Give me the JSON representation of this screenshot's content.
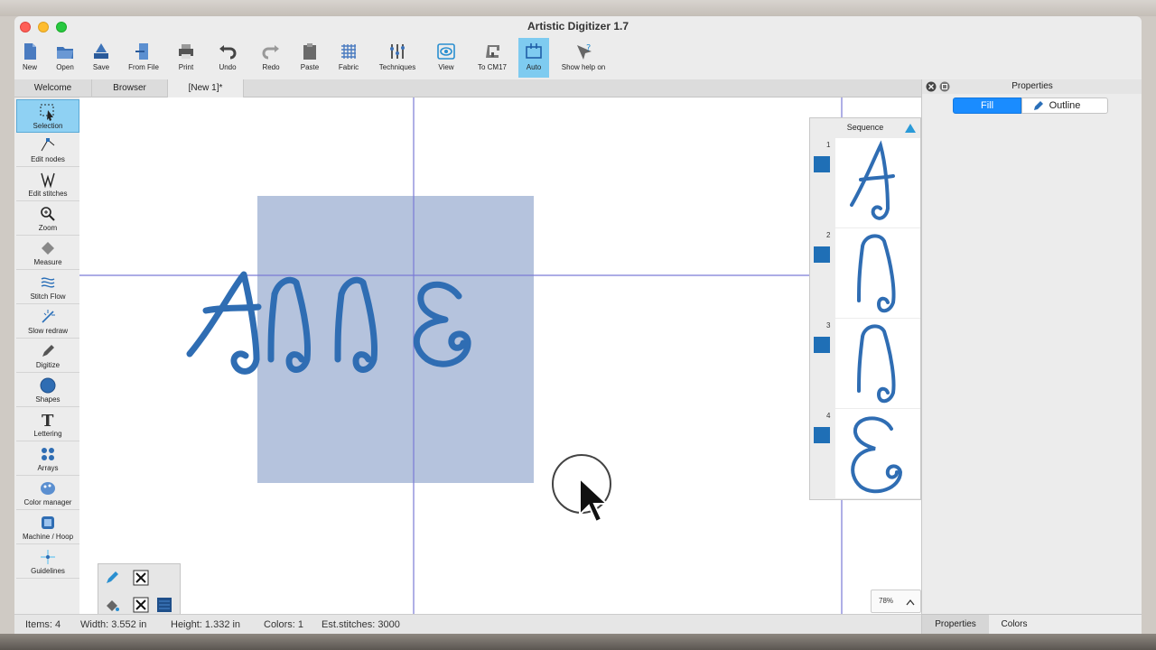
{
  "window": {
    "title": "Artistic Digitizer 1.7"
  },
  "toolbar": [
    {
      "label": "New",
      "icon": "new-file-icon"
    },
    {
      "label": "Open",
      "icon": "open-folder-icon"
    },
    {
      "label": "Save",
      "icon": "save-icon"
    },
    {
      "label": "From File",
      "icon": "from-file-icon"
    },
    {
      "label": "Print",
      "icon": "print-icon"
    },
    {
      "label": "Undo",
      "icon": "undo-icon"
    },
    {
      "label": "Redo",
      "icon": "redo-icon"
    },
    {
      "label": "Paste",
      "icon": "paste-icon"
    },
    {
      "label": "Fabric",
      "icon": "fabric-icon"
    },
    {
      "label": "Techniques",
      "icon": "techniques-icon"
    },
    {
      "label": "View",
      "icon": "view-icon"
    },
    {
      "label": "To CM17",
      "icon": "machine-icon"
    },
    {
      "label": "Auto",
      "icon": "auto-icon"
    },
    {
      "label": "Show help on",
      "icon": "help-cursor-icon"
    }
  ],
  "tabs": [
    {
      "label": "Welcome"
    },
    {
      "label": "Browser"
    },
    {
      "label": "[New 1]*"
    }
  ],
  "tools": [
    {
      "label": "Selection"
    },
    {
      "label": "Edit nodes"
    },
    {
      "label": "Edit stitches"
    },
    {
      "label": "Zoom"
    },
    {
      "label": "Measure"
    },
    {
      "label": "Stitch Flow"
    },
    {
      "label": "Slow redraw"
    },
    {
      "label": "Digitize"
    },
    {
      "label": "Shapes"
    },
    {
      "label": "Lettering"
    },
    {
      "label": "Arrays"
    },
    {
      "label": "Color manager"
    },
    {
      "label": "Machine / Hoop"
    },
    {
      "label": "Guidelines"
    }
  ],
  "canvas": {
    "text": "ANNE",
    "zoom": "78%"
  },
  "sequence": {
    "title": "Sequence",
    "items": [
      {
        "number": "1",
        "glyph": "A"
      },
      {
        "number": "2",
        "glyph": "N"
      },
      {
        "number": "3",
        "glyph": "N"
      },
      {
        "number": "4",
        "glyph": "E"
      }
    ]
  },
  "properties": {
    "title": "Properties",
    "fill_label": "Fill",
    "outline_label": "Outline",
    "bottom_tabs": [
      "Properties",
      "Colors"
    ]
  },
  "status": {
    "items": "Items: 4",
    "width": "Width: 3.552 in",
    "height": "Height: 1.332 in",
    "colors": "Colors: 1",
    "stitches": "Est.stitches: 3000"
  },
  "colors": {
    "thread": "#2f6db3",
    "selection": "#b5c3dd",
    "guide": "#7a7ad6",
    "accent": "#7ecbf0"
  }
}
